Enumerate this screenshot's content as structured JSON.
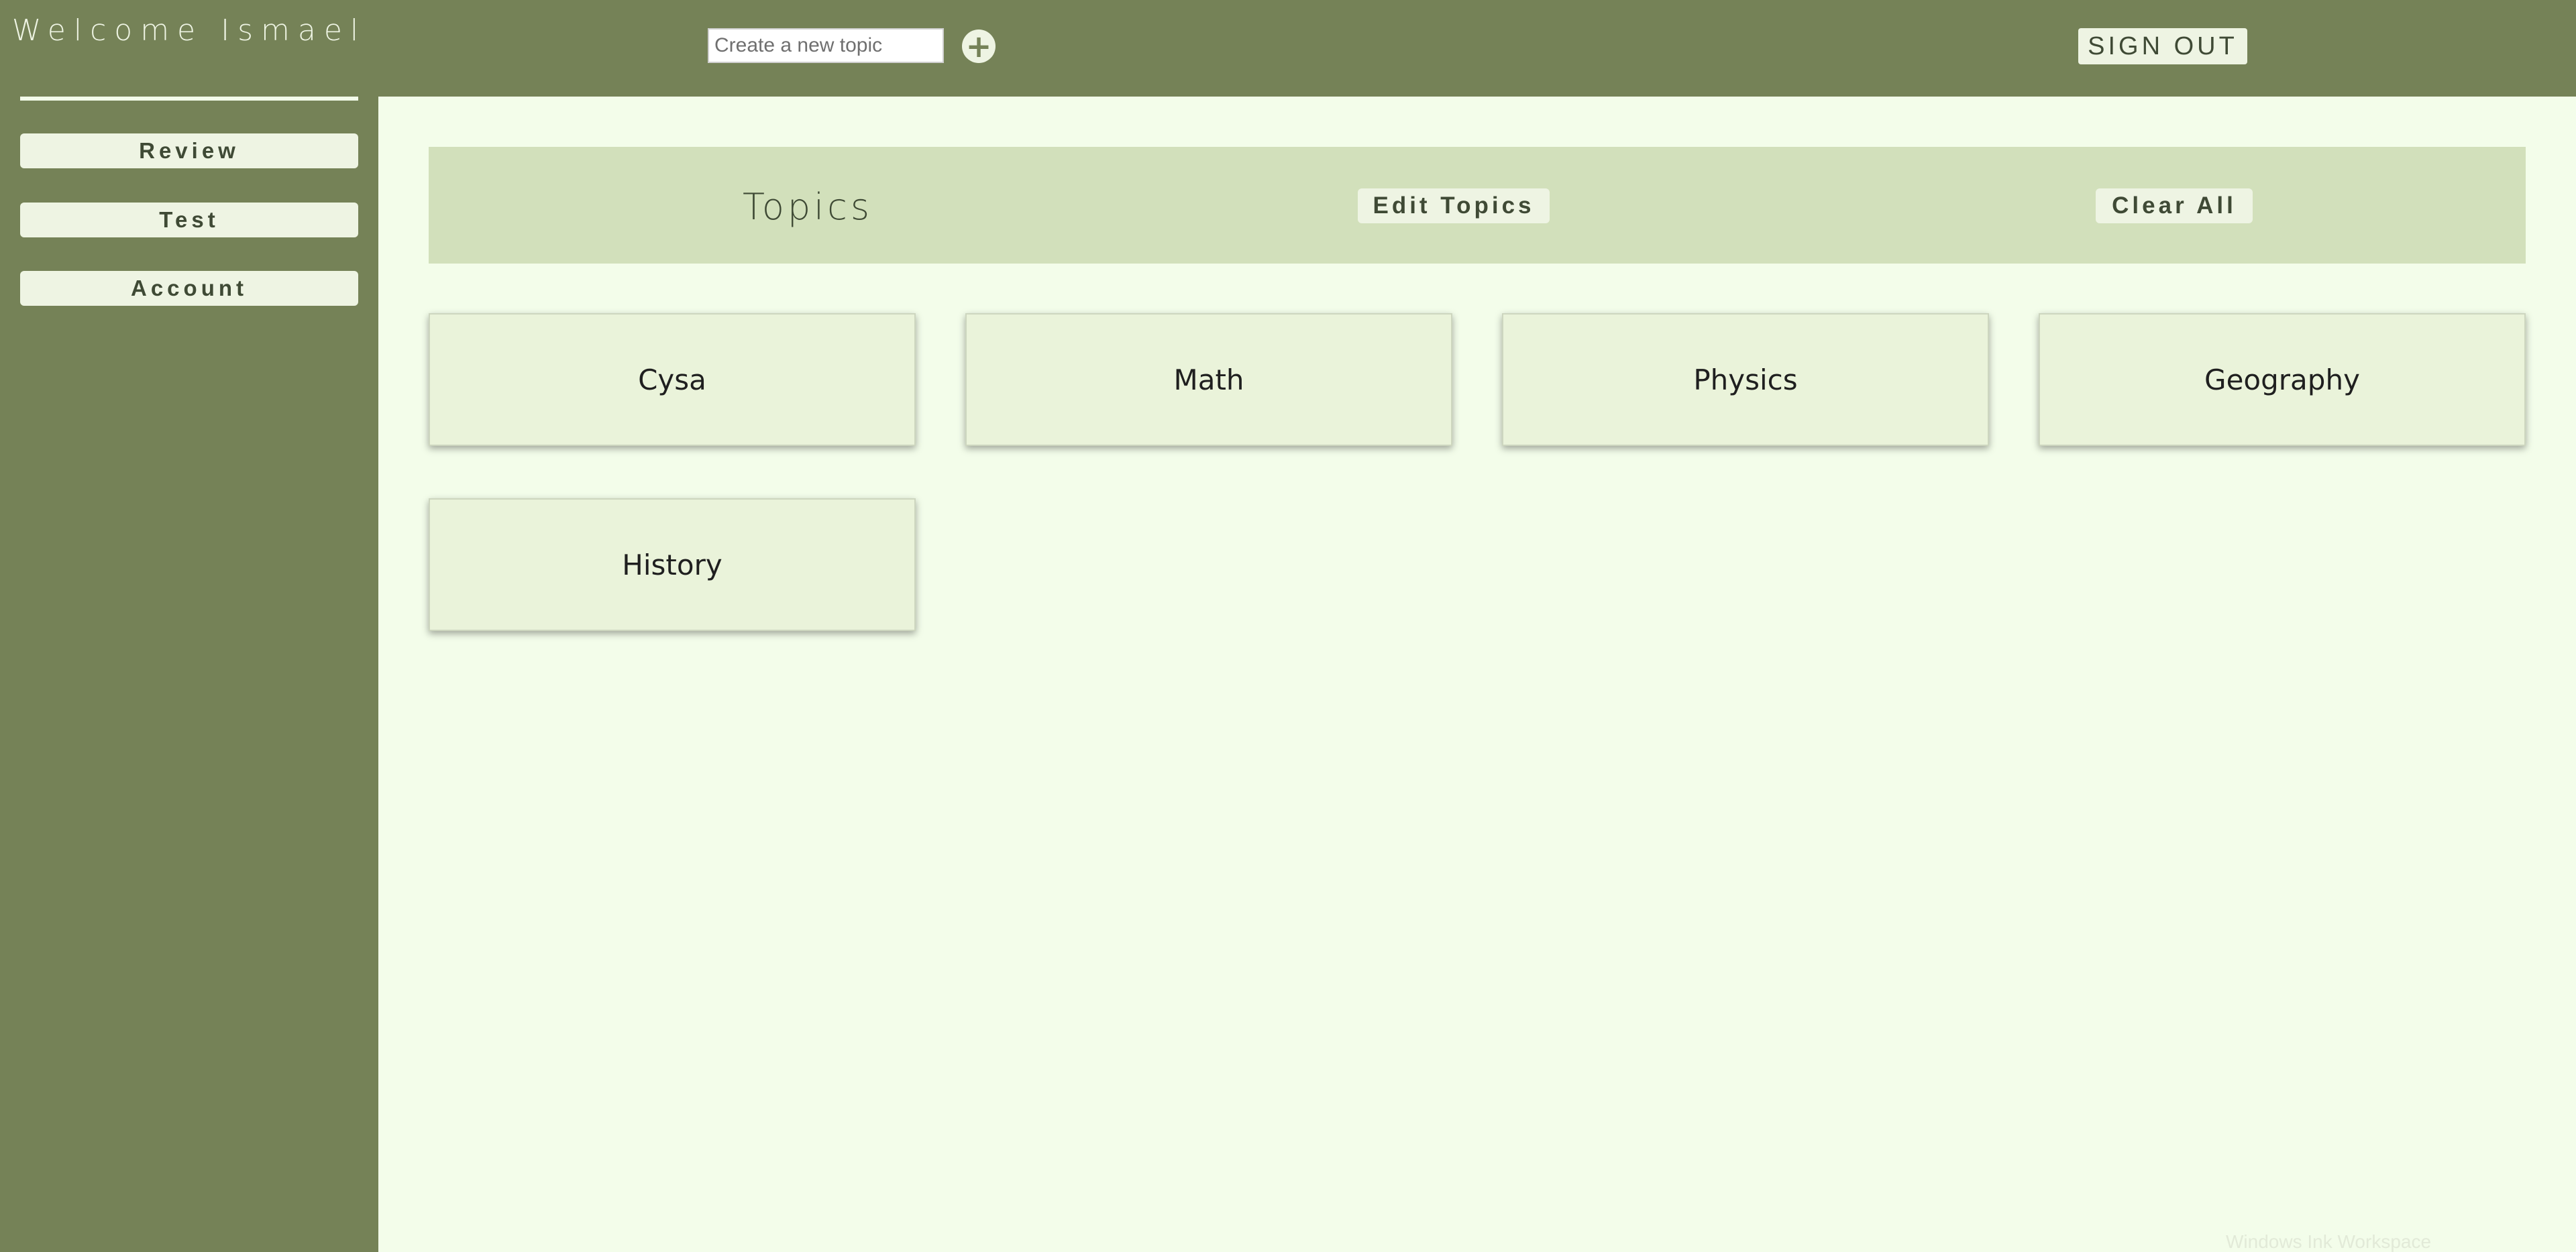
{
  "header": {
    "welcome": "Welcome Ismael",
    "topic_input": {
      "placeholder": "Create a new topic",
      "value": ""
    },
    "add_button_symbol": "+",
    "sign_out_label": "SIGN OUT"
  },
  "sidebar": {
    "items": [
      {
        "label": "Review"
      },
      {
        "label": "Test"
      },
      {
        "label": "Account"
      }
    ]
  },
  "main": {
    "title": "Topics",
    "edit_label": "Edit Topics",
    "clear_label": "Clear All",
    "topics": [
      {
        "label": "Cysa"
      },
      {
        "label": "Math"
      },
      {
        "label": "Physics"
      },
      {
        "label": "Geography"
      },
      {
        "label": "History"
      }
    ]
  },
  "watermark": "Windows Ink Workspace",
  "colors": {
    "bar": "#758257",
    "background": "#f3fdea",
    "header_panel": "#d2e0bb",
    "card": "#eaf3da",
    "button": "#eef4e3"
  }
}
